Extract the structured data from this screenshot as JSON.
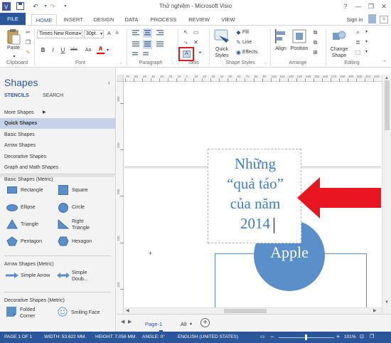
{
  "window": {
    "title": "Thử nghiệm - Microsoft Visio",
    "help": "?",
    "minimize": "—",
    "restore": "❐",
    "close": "✕",
    "sign_in": "Sign in"
  },
  "tabs": [
    "FILE",
    "HOME",
    "INSERT",
    "DESIGN",
    "DATA",
    "PROCESS",
    "REVIEW",
    "VIEW"
  ],
  "ribbon": {
    "clipboard": {
      "paste": "Paste",
      "label": "Clipboard"
    },
    "font": {
      "family": "Times New Roma",
      "size": "30pt.",
      "bold": "B",
      "italic": "I",
      "underline": "U",
      "strike": "abc",
      "case": "Aa",
      "label": "Font"
    },
    "paragraph": {
      "label": "Paragraph"
    },
    "tools": {
      "label": "Tools"
    },
    "shape_styles": {
      "quick_styles": "Quick Styles",
      "fill": "Fill",
      "line": "Line",
      "effects": "Effects",
      "label": "Shape Styles"
    },
    "arrange": {
      "align": "Align",
      "position": "Position",
      "label": "Arrange"
    },
    "editing": {
      "change_shape": "Change Shape",
      "label": "Editing"
    }
  },
  "panel": {
    "title": "Shapes",
    "tab_stencils": "STENCILS",
    "tab_search": "SEARCH",
    "stencils": [
      "More Shapes",
      "Quick Shapes",
      "Basic Shapes",
      "Arrow Shapes",
      "Decorative Shapes",
      "Graph and Math Shapes"
    ],
    "basic_section": "Basic Shapes (Metric)",
    "basic_shapes": [
      "Rectangle",
      "Square",
      "Ellipse",
      "Circle",
      "Triangle",
      "Right Triangle",
      "Pentagon",
      "Hexagon"
    ],
    "arrow_section": "Arrow Shapes (Metric)",
    "arrow_shapes": [
      "Simple Arrow",
      "Simple Doub..."
    ],
    "decor_section": "Decorative Shapes (Metric)",
    "decor_shapes": [
      "Folded Corner",
      "Smiling Face"
    ]
  },
  "rulers": {
    "h": [
      "80",
      "70",
      "60",
      "50",
      "40",
      "30",
      "20",
      "10",
      "0",
      "10",
      "20",
      "30",
      "40",
      "50",
      "60",
      "70",
      "80",
      "90",
      "100",
      "110",
      "120",
      "130",
      "140",
      "150",
      "160",
      "170",
      "180",
      "190",
      "200",
      "210",
      "220"
    ],
    "v": [
      "300",
      "250",
      "200",
      "150",
      "100"
    ]
  },
  "canvas": {
    "textbox_lines": [
      "Những",
      "“quả táo”",
      "của năm",
      "2014"
    ],
    "circle_label": "Apple"
  },
  "pages": {
    "current": "Page-1",
    "all": "All",
    "add": "+"
  },
  "status": {
    "page": "PAGE 1 OF 1",
    "width": "WIDTH: 53.622 MM.",
    "height": "HEIGHT: 7.056 MM.",
    "angle": "ANGLE: 0°",
    "language": "ENGLISH (UNITED STATES)",
    "zoom": "101%"
  },
  "colors": {
    "accent": "#2b579a",
    "shape_fill": "#5b8fc9",
    "arrow": "#e8141f",
    "text_blue": "#3d7cc4"
  }
}
